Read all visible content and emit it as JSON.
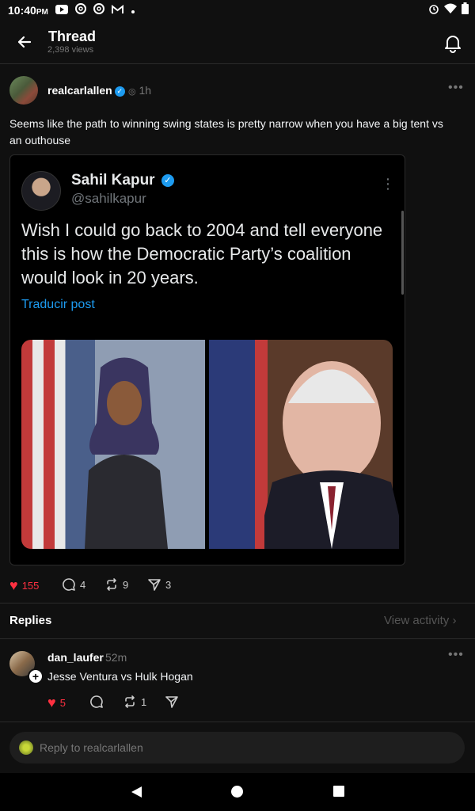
{
  "status_bar": {
    "time": "10:40",
    "ampm": "PM",
    "icons_left": [
      "youtube-icon",
      "threads-icon",
      "threads-icon",
      "gmail-icon",
      "dot-icon"
    ],
    "icons_right": [
      "alarm-icon",
      "wifi-icon",
      "battery-icon"
    ]
  },
  "header": {
    "title": "Thread",
    "views": "2,398 views"
  },
  "post": {
    "username": "realcarlallen",
    "time": "1h",
    "text": "Seems like the path to winning swing states is pretty narrow when you have a big tent vs an outhouse",
    "embedded_tweet": {
      "name": "Sahil Kapur",
      "handle": "@sahilkapur",
      "text": "Wish I could go back to 2004 and tell everyone this is how the Democratic Party’s coalition would look in 20 years.",
      "translate": "Traducir post"
    },
    "likes": "155",
    "comments": "4",
    "reposts": "9",
    "shares": "3"
  },
  "replies_section": {
    "label": "Replies",
    "view_activity": "View activity"
  },
  "reply": {
    "username": "dan_laufer",
    "time": "52m",
    "text": "Jesse Ventura vs Hulk Hogan",
    "likes": "5",
    "reposts": "1"
  },
  "reply_input": {
    "placeholder": "Reply to realcarlallen"
  },
  "colors": {
    "background": "#101010",
    "accent_like": "#ff3040",
    "verified": "#1d9bf0"
  }
}
